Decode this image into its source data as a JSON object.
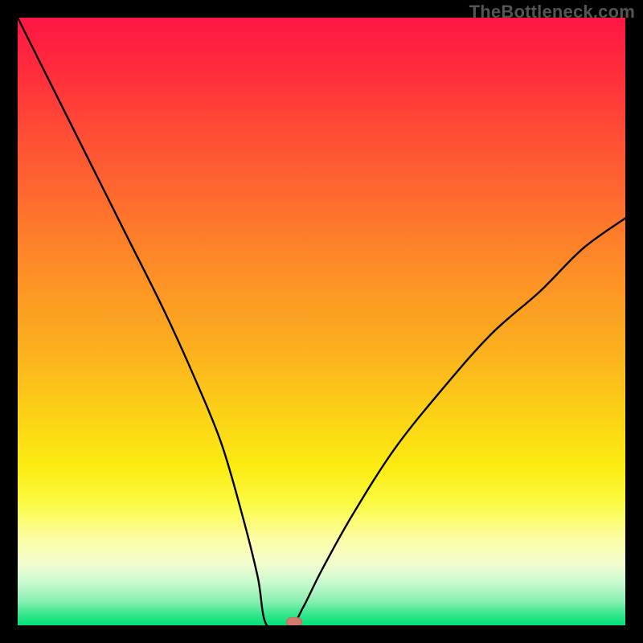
{
  "watermark": "TheBottleneck.com",
  "chart_data": {
    "type": "line",
    "title": "",
    "xlabel": "",
    "ylabel": "",
    "xlim": [
      0,
      100
    ],
    "ylim": [
      0,
      100
    ],
    "series": [
      {
        "name": "bottleneck-curve",
        "x": [
          0,
          6,
          12,
          18,
          24,
          29,
          33.5,
          37,
          39.5,
          41,
          45,
          47,
          50,
          55,
          62,
          70,
          78,
          86,
          93,
          100
        ],
        "values": [
          100,
          88,
          76,
          64,
          52,
          41,
          30,
          18,
          8,
          0,
          0,
          3,
          9,
          18,
          29,
          39,
          48,
          55,
          62,
          67
        ]
      }
    ],
    "marker": {
      "x": 45.5,
      "y": 0.5,
      "color": "#d47a6a"
    },
    "background_gradient": {
      "top": "#ff1744",
      "mid": "#fbec12",
      "bottom": "#00e176"
    }
  }
}
